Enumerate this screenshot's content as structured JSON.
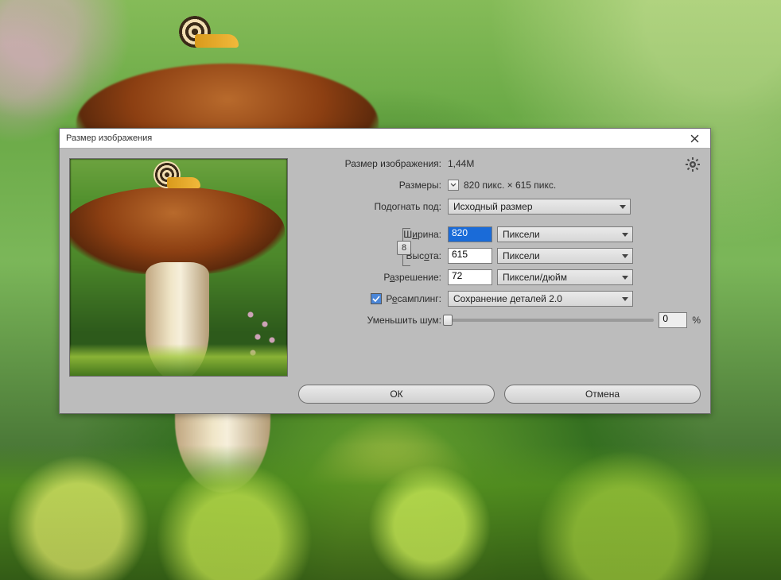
{
  "dialog": {
    "title": "Размер изображения",
    "size_label": "Размер изображения:",
    "size_value": "1,44M",
    "dimensions_label": "Размеры:",
    "dimensions_value": "820 пикс. × 615 пикс.",
    "fit_label": "Подогнать под:",
    "fit_value": "Исходный размер",
    "width_label_pre": "Ш",
    "width_label_u": "и",
    "width_label_post": "рина:",
    "width_value": "820",
    "width_unit": "Пиксели",
    "height_label_pre": "Выс",
    "height_label_u": "о",
    "height_label_post": "та:",
    "height_value": "615",
    "height_unit": "Пиксели",
    "resolution_label_pre": "Р",
    "resolution_label_u": "а",
    "resolution_label_post": "зрешение:",
    "resolution_value": "72",
    "resolution_unit": "Пиксели/дюйм",
    "resample_label_pre": "Р",
    "resample_label_u": "е",
    "resample_label_post": "самплинг:",
    "resample_value": "Сохранение деталей 2.0",
    "noise_label": "Уменьшить шум:",
    "noise_value": "0",
    "noise_suffix": "%",
    "ok_label": "ОК",
    "cancel_label": "Отмена",
    "link_icon_glyph": "8"
  }
}
